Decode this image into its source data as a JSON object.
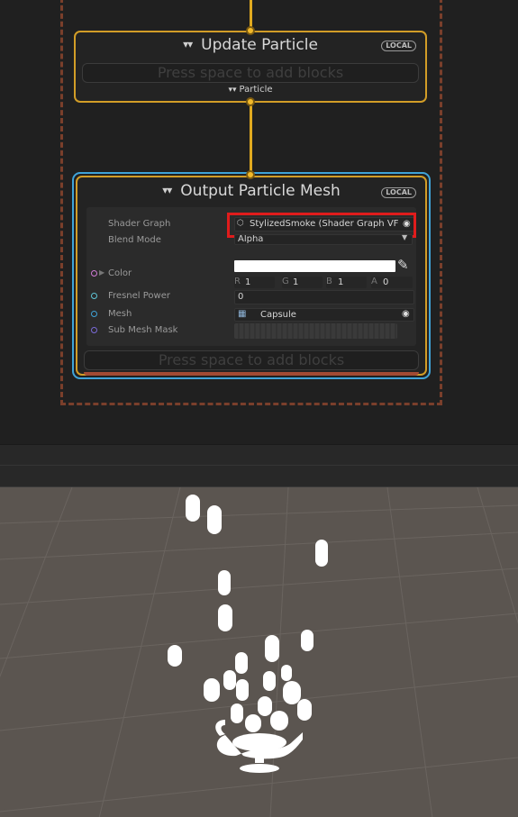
{
  "update_context": {
    "title": "Update Particle",
    "badge": "LOCAL",
    "placeholder": "Press space to add blocks",
    "subtitle": "Particle"
  },
  "output_context": {
    "title": "Output Particle Mesh",
    "badge": "LOCAL",
    "placeholder": "Press space to add blocks",
    "properties": {
      "shader_graph_label": "Shader Graph",
      "shader_graph_value": "StylizedSmoke (Shader Graph VF",
      "blend_mode_label": "Blend Mode",
      "blend_mode_value": "Alpha",
      "color_label": "Color",
      "color_r_label": "R",
      "color_r": "1",
      "color_g_label": "G",
      "color_g": "1",
      "color_b_label": "B",
      "color_b": "1",
      "color_a_label": "A",
      "color_a": "0",
      "fresnel_label": "Fresnel Power",
      "fresnel_value": "0",
      "mesh_label": "Mesh",
      "mesh_value": "Capsule",
      "submesh_label": "Sub Mesh Mask"
    }
  },
  "colors": {
    "flow": "#e0a91f",
    "context_border": "#d29d27",
    "selection": "#3fa3d8",
    "highlight": "#e01c1c",
    "system_border": "#7a3f2b",
    "scene_bg": "#5b5550"
  }
}
